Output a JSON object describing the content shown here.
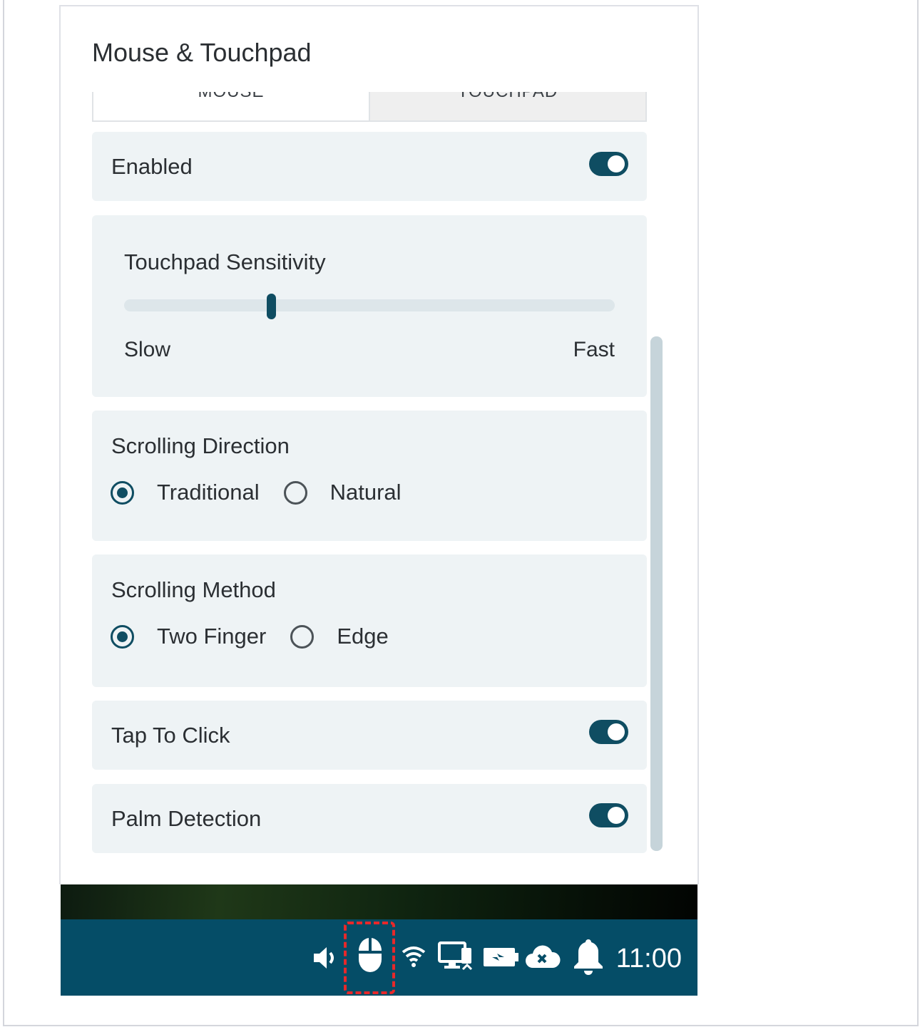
{
  "window": {
    "title": "Mouse & Touchpad"
  },
  "tabs": [
    {
      "label": "MOUSE",
      "active": true
    },
    {
      "label": "TOUCHPAD",
      "active": false
    }
  ],
  "enabled": {
    "label": "Enabled",
    "on": true
  },
  "sensitivity": {
    "title": "Touchpad Sensitivity",
    "min_label": "Slow",
    "max_label": "Fast",
    "value_fraction": 0.3
  },
  "scrolling_direction": {
    "title": "Scrolling Direction",
    "options": [
      {
        "label": "Traditional",
        "selected": true
      },
      {
        "label": "Natural",
        "selected": false
      }
    ]
  },
  "scrolling_method": {
    "title": "Scrolling Method",
    "options": [
      {
        "label": "Two Finger",
        "selected": true
      },
      {
        "label": "Edge",
        "selected": false
      }
    ]
  },
  "tap_to_click": {
    "label": "Tap To Click",
    "on": true
  },
  "palm_detection": {
    "label": "Palm Detection",
    "on": true
  },
  "taskbar": {
    "icons": [
      "speaker-icon",
      "mouse-icon",
      "wifi-icon",
      "display-icon",
      "battery-charging-icon",
      "cloud-error-icon",
      "bell-icon"
    ],
    "clock": "11:00",
    "highlighted_icon": "mouse-icon"
  },
  "colors": {
    "accent": "#0f4d62",
    "taskbar": "#054d67",
    "card_bg": "#eef3f5",
    "highlight": "#e8282a"
  }
}
